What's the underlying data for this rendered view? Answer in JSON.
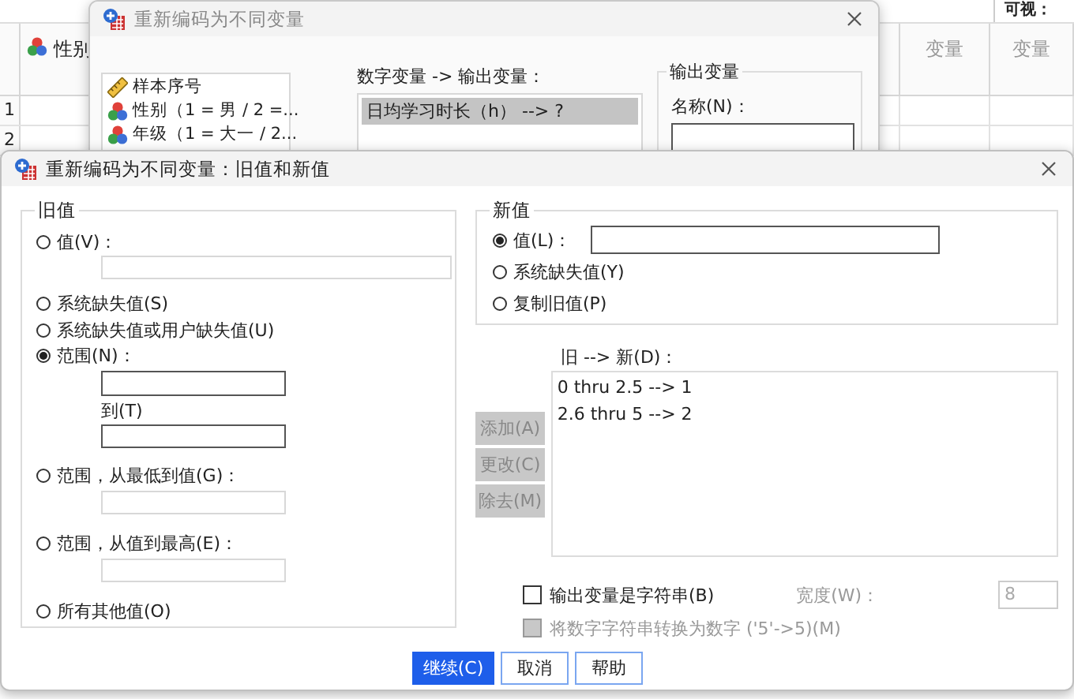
{
  "sheet": {
    "visible_label": "可视：",
    "columns": [
      {
        "label": "性别",
        "kind": "nominal"
      },
      {
        "label": "变量",
        "kind": "empty"
      },
      {
        "label": "变量",
        "kind": "empty"
      }
    ],
    "rows": [
      "1",
      "2"
    ]
  },
  "back_dialog": {
    "title": "重新编码为不同变量",
    "variables": [
      {
        "label": "样本序号",
        "kind": "scale"
      },
      {
        "label": "性别（1 = 男 / 2 =...",
        "kind": "nominal"
      },
      {
        "label": "年级（1 = 大一 / 2...",
        "kind": "nominal"
      }
    ],
    "mapping_label": "数字变量 -> 输出变量：",
    "mappings": [
      {
        "text": "日均学习时长（h） --> ?",
        "selected": true
      }
    ],
    "output_group": "输出变量",
    "name_label": "名称(N)："
  },
  "dialog": {
    "title": "重新编码为不同变量：旧值和新值",
    "old_value": {
      "legend": "旧值",
      "options": [
        {
          "kind": "field",
          "label": "值(V)：",
          "selected": false
        },
        {
          "kind": "plain",
          "label": "系统缺失值(S)",
          "selected": false
        },
        {
          "kind": "plain",
          "label": "系统缺失值或用户缺失值(U)",
          "selected": false
        },
        {
          "kind": "range",
          "label": "范围(N)：",
          "to_label": "到(T)",
          "selected": true
        },
        {
          "kind": "bound",
          "label": "范围，从最低到值(G)：",
          "selected": false
        },
        {
          "kind": "bound",
          "label": "范围，从值到最高(E)：",
          "selected": false
        },
        {
          "kind": "plain",
          "label": "所有其他值(O)",
          "selected": false
        }
      ]
    },
    "new_value": {
      "legend": "新值",
      "options": [
        {
          "kind": "field",
          "label": "值(L)：",
          "selected": true
        },
        {
          "kind": "plain",
          "label": "系统缺失值(Y)",
          "selected": false
        },
        {
          "kind": "plain",
          "label": "复制旧值(P)",
          "selected": false
        }
      ]
    },
    "pairs_label": "旧 --> 新(D)：",
    "pairs": [
      "0 thru 2.5 --> 1",
      "2.6 thru 5 --> 2"
    ],
    "list_buttons": [
      {
        "label": "添加(A)",
        "disabled": true
      },
      {
        "label": "更改(C)",
        "disabled": true
      },
      {
        "label": "除去(M)",
        "disabled": true
      }
    ],
    "string_output": {
      "label": "输出变量是字符串(B)",
      "checked": false,
      "disabled": false
    },
    "width": {
      "label": "宽度(W)：",
      "value": "8",
      "disabled": true
    },
    "convert": {
      "label": "将数字字符串转换为数字 ('5'->5)(M)",
      "checked": false,
      "disabled": true
    },
    "buttons": [
      {
        "label": "继续(C)",
        "kind": "primary"
      },
      {
        "label": "取消",
        "kind": "normal"
      },
      {
        "label": "帮助",
        "kind": "normal"
      }
    ]
  }
}
